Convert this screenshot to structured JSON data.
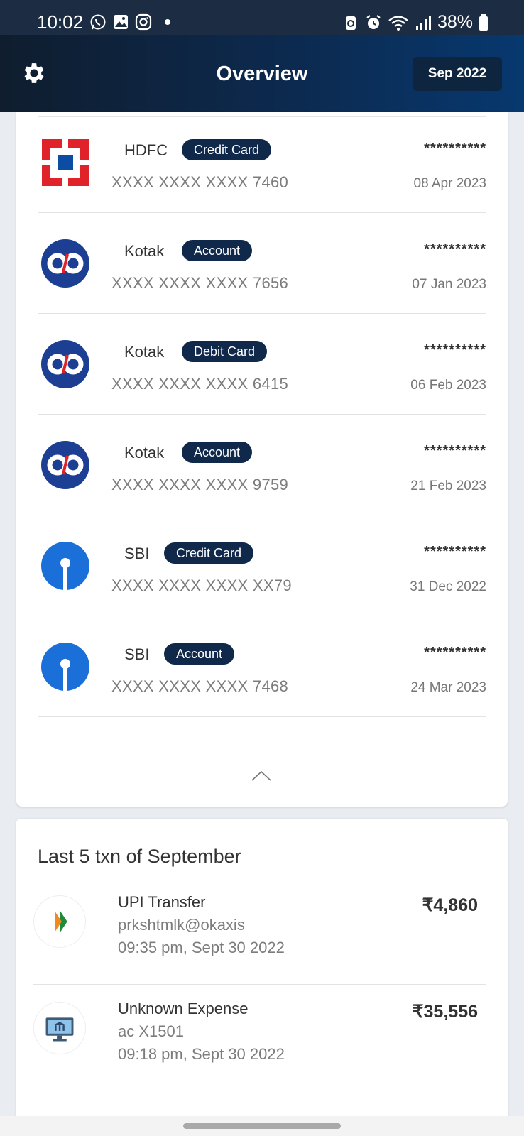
{
  "status_bar": {
    "time": "10:02",
    "battery": "38%",
    "left_icons": [
      "whatsapp-icon",
      "gallery-icon",
      "instagram-icon",
      "dot-icon"
    ],
    "right_icons": [
      "battery-saver-icon",
      "alarm-icon",
      "wifi-icon",
      "signal-icon",
      "battery-icon"
    ]
  },
  "header": {
    "title": "Overview",
    "month": "Sep 2022"
  },
  "accounts": [
    {
      "bank": "HDFC",
      "type": "Credit Card",
      "number": "XXXX XXXX XXXX 7460",
      "balance": "**********",
      "date": "08 Apr 2023",
      "logo": "hdfc-logo"
    },
    {
      "bank": "Kotak",
      "type": "Account",
      "number": "XXXX XXXX XXXX 7656",
      "balance": "**********",
      "date": "07 Jan 2023",
      "logo": "kotak-logo"
    },
    {
      "bank": "Kotak",
      "type": "Debit Card",
      "number": "XXXX XXXX XXXX 6415",
      "balance": "**********",
      "date": "06 Feb 2023",
      "logo": "kotak-logo"
    },
    {
      "bank": "Kotak",
      "type": "Account",
      "number": "XXXX XXXX XXXX 9759",
      "balance": "**********",
      "date": "21 Feb 2023",
      "logo": "kotak-logo"
    },
    {
      "bank": "SBI",
      "type": "Credit Card",
      "number": "XXXX XXXX XXXX XX79",
      "balance": "**********",
      "date": "31 Dec 2022",
      "logo": "sbi-logo"
    },
    {
      "bank": "SBI",
      "type": "Account",
      "number": "XXXX XXXX XXXX 7468",
      "balance": "**********",
      "date": "24 Mar 2023",
      "logo": "sbi-logo"
    }
  ],
  "transactions": {
    "heading": "Last 5 txn of September",
    "items": [
      {
        "title": "UPI Transfer",
        "sub": "prkshtmlk@okaxis",
        "time": "09:35 pm, Sept 30 2022",
        "amount": "₹4,860",
        "icon": "upi-icon"
      },
      {
        "title": "Unknown Expense",
        "sub": "ac X1501",
        "time": "09:18 pm, Sept 30 2022",
        "amount": "₹35,556",
        "icon": "bank-icon"
      }
    ]
  },
  "colors": {
    "header_dark": "#0f1d2e",
    "header_blue": "#07386f",
    "pill": "#10294a",
    "hdfc_red": "#e0232a",
    "hdfc_blue": "#0a4da3",
    "kotak_blue": "#1c3f94",
    "sbi_blue": "#1a6fd8"
  }
}
